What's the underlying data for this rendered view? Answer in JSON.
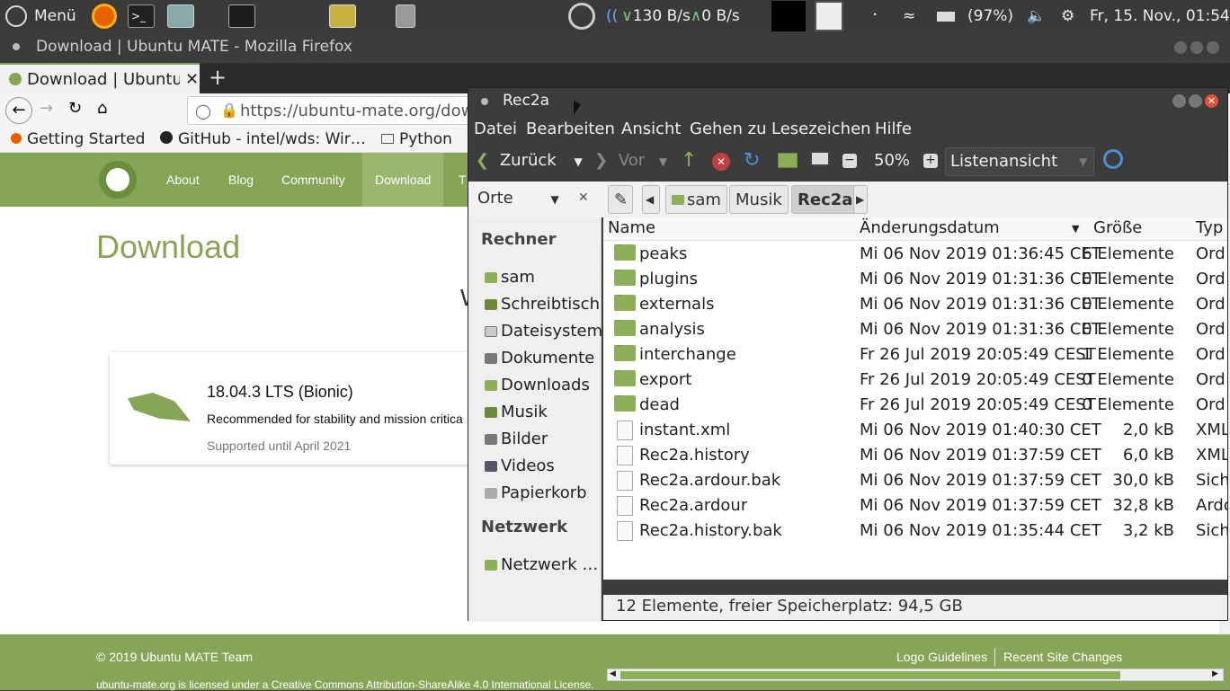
{
  "panel": {
    "menu_label": "Menü",
    "net_down": "130 B/s",
    "net_up": "0 B/s",
    "battery": "(97%)",
    "clock": "Fr, 15. Nov., 01:54"
  },
  "firefox": {
    "window_title": "Download | Ubuntu MATE - Mozilla Firefox",
    "tab_title": "Download | Ubuntu",
    "url": "https://ubuntu-mate.org/dow",
    "bookmarks": [
      "Getting Started",
      "GitHub - intel/wds: Wir…",
      "Python"
    ],
    "site": {
      "nav": [
        "About",
        "Blog",
        "Community",
        "Download",
        "T"
      ],
      "heading": "Download",
      "partial_letter": "W",
      "release_title": "18.04.3 LTS (Bionic)",
      "release_desc": "Recommended for stability and mission critica",
      "release_support": "Supported until April 2021",
      "footer_copyright": "© 2019 Ubuntu MATE Team",
      "footer_license": "ubuntu-mate.org is licensed under a Creative Commons Attribution-ShareAlike 4.0 International License.",
      "footer_links": [
        "Logo Guidelines",
        "Recent Site Changes"
      ]
    }
  },
  "caja": {
    "title": "Rec2a",
    "menu": [
      "Datei",
      "Bearbeiten",
      "Ansicht",
      "Gehen zu",
      "Lesezeichen",
      "Hilfe"
    ],
    "toolbar": {
      "back": "Zurück",
      "forward": "Vor",
      "zoom": "50%",
      "view_mode": "Listenansicht"
    },
    "location": {
      "places_label": "Orte",
      "crumbs": [
        "sam",
        "Musik",
        "Rec2a"
      ]
    },
    "sidebar": {
      "section_computer": "Rechner",
      "items": [
        "sam",
        "Schreibtisch",
        "Dateisystem",
        "Dokumente",
        "Downloads",
        "Musik",
        "Bilder",
        "Videos",
        "Papierkorb"
      ],
      "section_network": "Netzwerk",
      "network_items": [
        "Netzwerk …"
      ]
    },
    "columns": [
      "Name",
      "Änderungsdatum",
      "Größe",
      "Typ"
    ],
    "files": [
      {
        "name": "peaks",
        "date": "Mi 06 Nov 2019 01:36:45 CET",
        "size": "6 Elemente",
        "type": "Ord",
        "kind": "folder"
      },
      {
        "name": "plugins",
        "date": "Mi 06 Nov 2019 01:31:36 CET",
        "size": "0 Elemente",
        "type": "Ord",
        "kind": "folder"
      },
      {
        "name": "externals",
        "date": "Mi 06 Nov 2019 01:31:36 CET",
        "size": "0 Elemente",
        "type": "Ord",
        "kind": "folder"
      },
      {
        "name": "analysis",
        "date": "Mi 06 Nov 2019 01:31:36 CET",
        "size": "0 Elemente",
        "type": "Ord",
        "kind": "folder"
      },
      {
        "name": "interchange",
        "date": "Fr 26 Jul 2019 20:05:49 CEST",
        "size": "1 Elemente",
        "type": "Ord",
        "kind": "folder"
      },
      {
        "name": "export",
        "date": "Fr 26 Jul 2019 20:05:49 CEST",
        "size": "0 Elemente",
        "type": "Ord",
        "kind": "folder"
      },
      {
        "name": "dead",
        "date": "Fr 26 Jul 2019 20:05:49 CEST",
        "size": "0 Elemente",
        "type": "Ord",
        "kind": "folder"
      },
      {
        "name": "instant.xml",
        "date": "Mi 06 Nov 2019 01:40:30 CET",
        "size": "2,0 kB",
        "type": "XML",
        "kind": "file"
      },
      {
        "name": "Rec2a.history",
        "date": "Mi 06 Nov 2019 01:37:59 CET",
        "size": "6,0 kB",
        "type": "XML",
        "kind": "file"
      },
      {
        "name": "Rec2a.ardour.bak",
        "date": "Mi 06 Nov 2019 01:37:59 CET",
        "size": "30,0 kB",
        "type": "Sich",
        "kind": "file"
      },
      {
        "name": "Rec2a.ardour",
        "date": "Mi 06 Nov 2019 01:37:59 CET",
        "size": "32,8 kB",
        "type": "Ardo",
        "kind": "file"
      },
      {
        "name": "Rec2a.history.bak",
        "date": "Mi 06 Nov 2019 01:35:44 CET",
        "size": "3,2 kB",
        "type": "Sich",
        "kind": "file"
      }
    ],
    "status": "12 Elemente, freier Speicherplatz: 94,5 GB"
  }
}
